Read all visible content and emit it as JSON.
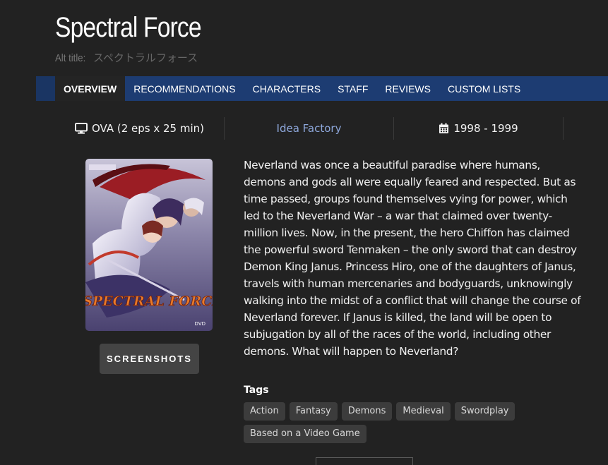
{
  "title": "Spectral Force",
  "alt_title": {
    "label": "Alt title:",
    "value": "スペクトラルフォース"
  },
  "tabs": [
    {
      "label": "OVERVIEW",
      "active": true
    },
    {
      "label": "RECOMMENDATIONS"
    },
    {
      "label": "CHARACTERS"
    },
    {
      "label": "STAFF"
    },
    {
      "label": "REVIEWS"
    },
    {
      "label": "CUSTOM LISTS"
    }
  ],
  "info": {
    "format": "OVA (2 eps x 25 min)",
    "format_icon": "monitor-icon",
    "studio": "Idea Factory",
    "years": "1998 - 1999",
    "years_icon": "calendar-icon"
  },
  "cover": {
    "logo_text": "SPECTRAL FORCE"
  },
  "screenshots_label": "SCREENSHOTS",
  "synopsis": "Neverland was once a beautiful paradise where humans, demons and gods all were equally feared and respected. But as time passed, groups found themselves vying for power, which led to the Neverland War – a war that claimed over twenty-million lives. Now, in the present, the hero Chiffon has claimed the powerful sword Tenmaken – the only sword that can destroy Demon King Janus. Princess Hiro, one of the daughters of Janus, travels with human mercenaries and bodyguards, unknowingly walking into the midst of a conflict that will change the course of Neverland forever. If Janus is killed, the land will be open to subjugation by all of the races of the world, including other demons. What will happen to Neverland?",
  "tags_heading": "Tags",
  "tags": [
    "Action",
    "Fantasy",
    "Demons",
    "Medieval",
    "Swordplay",
    "Based on a Video Game"
  ],
  "colors": {
    "background": "#222222",
    "tab_bar": "#1d3c72",
    "studio_link": "#8ea8dc",
    "tag_bg": "#3c3c3c"
  }
}
